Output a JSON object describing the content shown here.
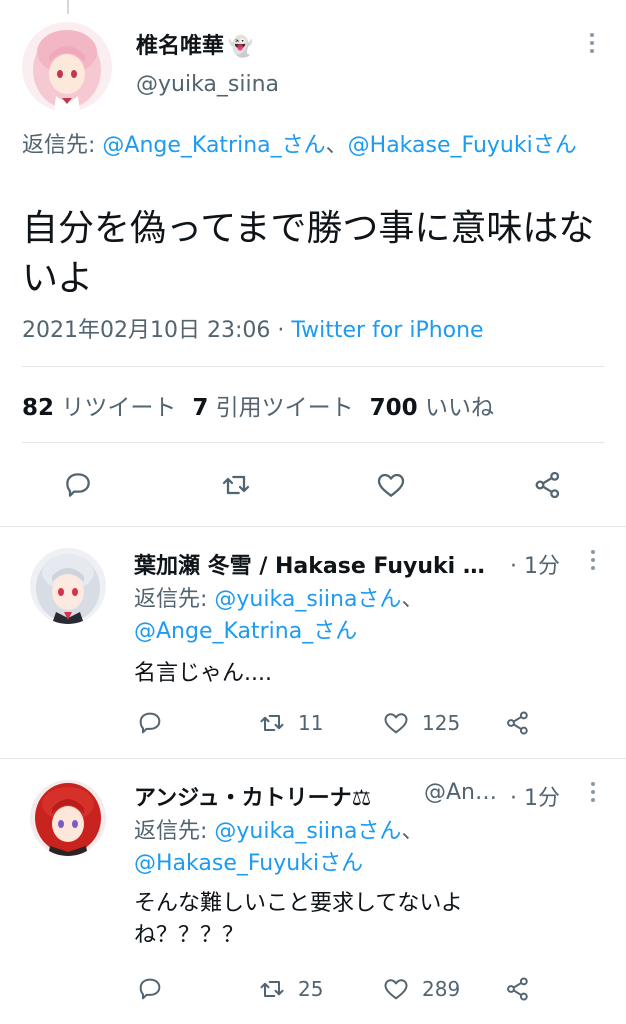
{
  "main_tweet": {
    "display_name": "椎名唯華",
    "name_emoji": "👻",
    "handle": "@yuika_siina",
    "reply_prefix": "返信先: ",
    "reply_to_1": "@Ange_Katrina_さん",
    "reply_sep": "、",
    "reply_to_2": "@Hakase_Fuyukiさん",
    "text": "自分を偽ってまで勝つ事に意味はないよ",
    "date": "2021年02月10日 23:06",
    "meta_sep": " · ",
    "source": "Twitter for iPhone",
    "retweets_count": "82",
    "retweets_label": "リツイート",
    "quotes_count": "7",
    "quotes_label": "引用ツイート",
    "likes_count": "700",
    "likes_label": "いいね"
  },
  "replies": [
    {
      "display_name": "葉加瀬 冬雪 / Hakase Fuyuki …",
      "time": "· 1分",
      "reply_prefix": "返信先: ",
      "reply_to_1": "@yuika_siinaさん",
      "reply_sep": "、",
      "reply_to_2": "@Ange_Katrina_さん",
      "text": "名言じゃん....",
      "retweets": "11",
      "likes": "125"
    },
    {
      "display_name": "アンジュ・カトリーナ⚖",
      "handle": "@An…",
      "time": "· 1分",
      "reply_prefix": "返信先: ",
      "reply_to_1": "@yuika_siinaさん",
      "reply_sep": "、",
      "reply_to_2": "@Hakase_Fuyukiさん",
      "text": "そんな難しいこと要求してないよね？？？？",
      "retweets": "25",
      "likes": "289"
    }
  ],
  "colors": {
    "link": "#1d9bf0",
    "secondary": "#536471",
    "divider": "#e1e6ea"
  },
  "icons": [
    "reply-icon",
    "retweet-icon",
    "like-icon",
    "share-icon",
    "more-icon"
  ]
}
